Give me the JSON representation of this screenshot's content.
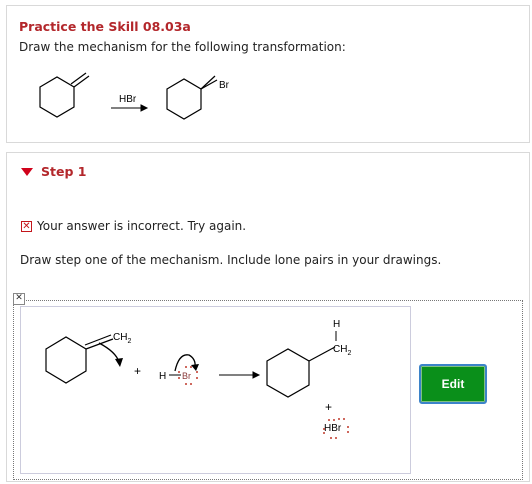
{
  "question": {
    "title": "Practice the Skill 08.03a",
    "prompt": "Draw the mechanism for the following transformation:",
    "reagent": "HBr",
    "product_substituent": "Br"
  },
  "step": {
    "title": "Step 1",
    "error_message": "Your answer is incorrect.  Try again.",
    "instruction": "Draw step one of the mechanism. Include lone pairs in your drawings."
  },
  "drawing": {
    "ch2_label": "CH",
    "ch2_sub": "2",
    "plus_sign": "+",
    "h_label": "H",
    "br_label": "Br",
    "product_h": "H",
    "product_ch2": "CH",
    "product_ch2_sub": "2",
    "hbr_label": "HBr"
  },
  "edit_button": {
    "label": "Edit"
  },
  "colors": {
    "title": "#b3272b",
    "edit_bg": "#0a8f1a",
    "edit_border": "#3c83c9",
    "lone_pair": "#c0392b"
  }
}
